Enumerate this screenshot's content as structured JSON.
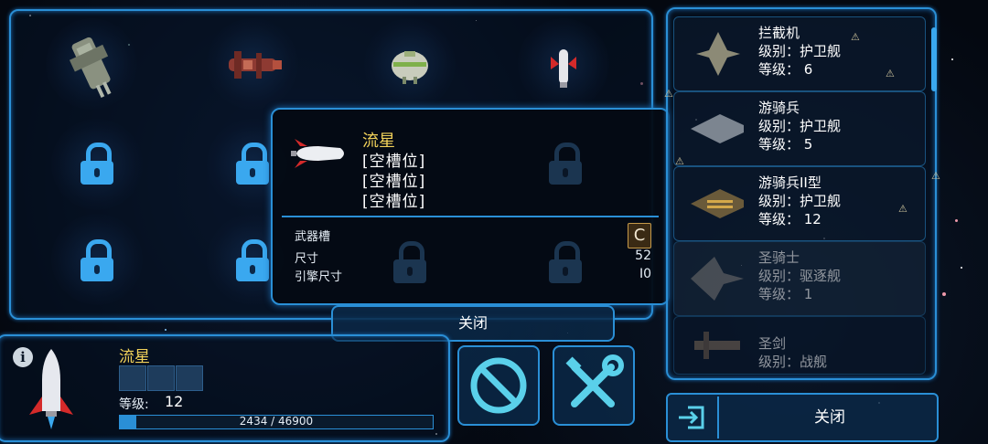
{
  "popup": {
    "title": "流星",
    "slots": [
      "[空槽位]",
      "[空槽位]",
      "[空槽位]"
    ],
    "weapon_slot_label": "武器槽",
    "weapon_slot_grade": "C",
    "size_label": "尺寸",
    "size_value": "52",
    "engine_size_label": "引擎尺寸",
    "engine_size_value": "I0",
    "close_label": "关闭"
  },
  "ship_list": [
    {
      "name": "拦截机",
      "class": "级别：护卫舰",
      "level": "等级： 6",
      "enabled": true
    },
    {
      "name": "游骑兵",
      "class": "级别：护卫舰",
      "level": "等级： 5",
      "enabled": true
    },
    {
      "name": "游骑兵II型",
      "class": "级别：护卫舰",
      "level": "等级： 12",
      "enabled": true
    },
    {
      "name": "圣骑士",
      "class": "级别：驱逐舰",
      "level": "等级： 1",
      "enabled": false
    },
    {
      "name": "圣剑",
      "class": "级别：战舰",
      "level": "",
      "enabled": false
    }
  ],
  "current_ship": {
    "name": "流星",
    "level_label": "等级:",
    "level_value": "12",
    "xp_text": "2434 / 46900",
    "xp_fraction": 0.052
  },
  "close_button_label": "关闭",
  "icons": {
    "info": "i",
    "cancel": "prohibit-icon",
    "tools": "wrench-screwdriver-icon",
    "exit": "exit-door-icon"
  },
  "colors": {
    "accent": "#2a8fd6",
    "title_gold": "#f2d25a",
    "lock_blue": "#3aa8ef"
  }
}
